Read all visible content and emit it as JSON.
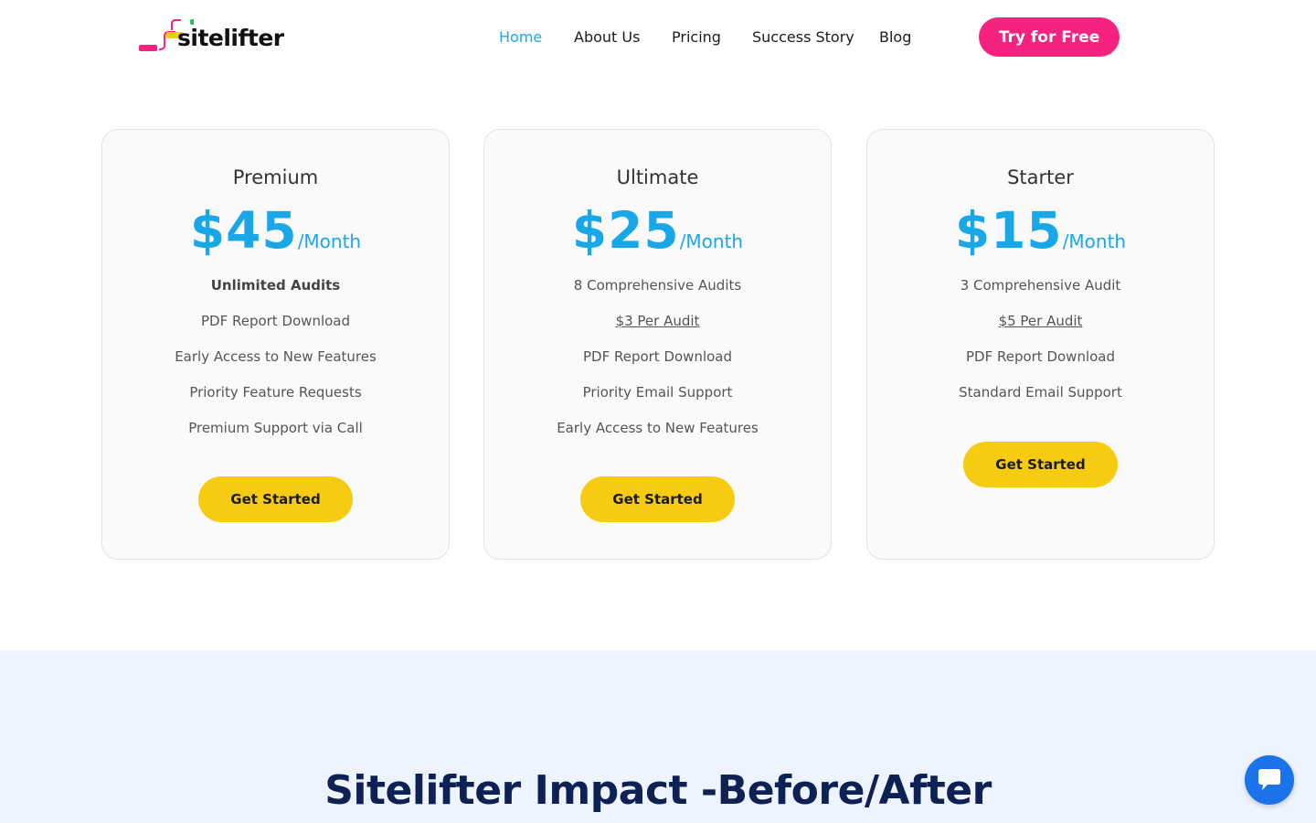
{
  "header": {
    "logo_text": "sitelifter",
    "nav": [
      {
        "label": "Home",
        "active": true
      },
      {
        "label": "About Us",
        "active": false
      },
      {
        "label": "Pricing",
        "active": false
      },
      {
        "label": "Success Story",
        "active": false
      },
      {
        "label": "Blog",
        "active": false
      }
    ],
    "cta_label": "Try for Free"
  },
  "plans": [
    {
      "name": "Premium",
      "price": "$45",
      "period": "/Month",
      "features": [
        "Unlimited Audits",
        "PDF Report Download",
        "Early Access to New Features",
        "Priority Feature Requests",
        "Premium Support via Call"
      ],
      "button": "Get Started"
    },
    {
      "name": "Ultimate",
      "price": "$25",
      "period": "/Month",
      "features": [
        "8 Comprehensive Audits",
        "$3 Per Audit",
        "PDF Report Download",
        "Priority Email Support",
        "Early Access to New Features"
      ],
      "button": "Get Started"
    },
    {
      "name": "Starter",
      "price": "$15",
      "period": "/Month",
      "features": [
        "3 Comprehensive Audit",
        "$5 Per Audit",
        "PDF Report Download",
        "Standard Email Support"
      ],
      "button": "Get Started"
    }
  ],
  "impact": {
    "title": "Sitelifter Impact -Before/After"
  },
  "colors": {
    "accent_blue": "#1aa7e8",
    "cta_pink": "#f5237f",
    "button_yellow": "#f8cb13",
    "heading_navy": "#0e2154",
    "section_bg": "#edf4fe"
  },
  "icons": {
    "chat": "chat-bubble-icon"
  }
}
